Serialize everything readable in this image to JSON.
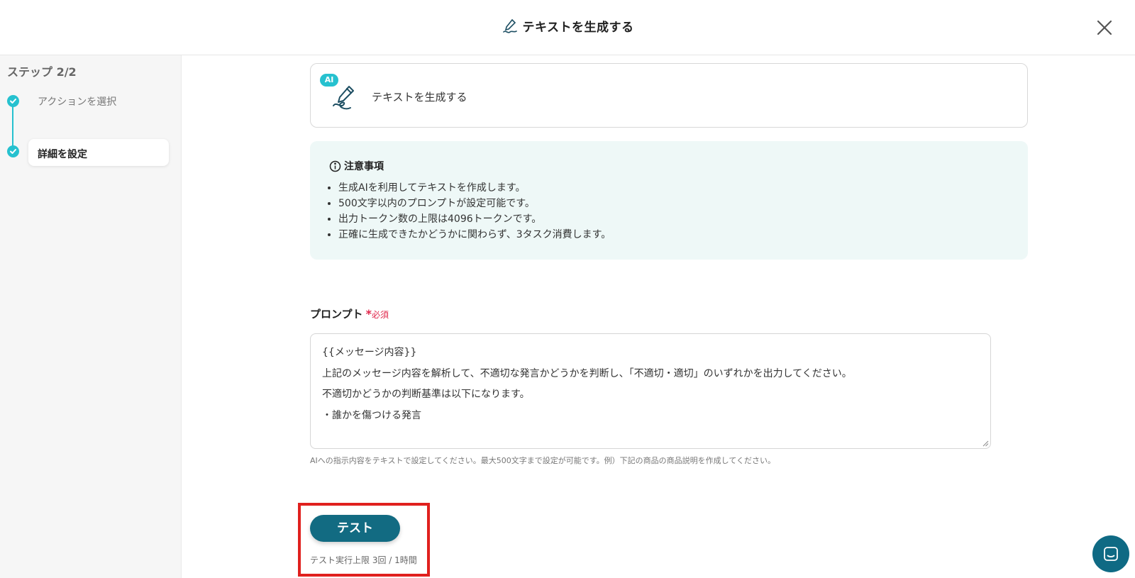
{
  "header": {
    "title": "テキストを生成する",
    "icon": "pen-icon"
  },
  "sidebar": {
    "step_title": "ステップ 2/2",
    "steps": [
      {
        "label": "アクションを選択",
        "done": true
      },
      {
        "label": "詳細を設定",
        "done": true,
        "active": true
      }
    ]
  },
  "action_card": {
    "badge": "AI",
    "label": "テキストを生成する"
  },
  "notice": {
    "title": "注意事項",
    "items": [
      "生成AIを利用してテキストを作成します。",
      "500文字以内のプロンプトが設定可能です。",
      "出力トークン数の上限は4096トークンです。",
      "正確に生成できたかどうかに関わらず、3タスク消費します。"
    ]
  },
  "prompt": {
    "label": "プロンプト",
    "required_mark": "*",
    "required_label": "必須",
    "lines": [
      "{{メッセージ内容}}",
      "上記のメッセージ内容を解析して、不適切な発言かどうかを判断し、「不適切・適切」のいずれかを出力してください。",
      "不適切かどうかの判断基準は以下になります。",
      "・誰かを傷つける発言"
    ],
    "help": "AIへの指示内容をテキストで設定してください。最大500文字まで設定が可能です。例）下記の商品の商品説明を作成してください。"
  },
  "test": {
    "button_label": "テスト",
    "limit_text": "テスト実行上限 3回 / 1時間"
  },
  "colors": {
    "accent": "#26c1cf",
    "primary": "#126b82",
    "required": "#e0264a",
    "highlight": "#e0201e"
  }
}
